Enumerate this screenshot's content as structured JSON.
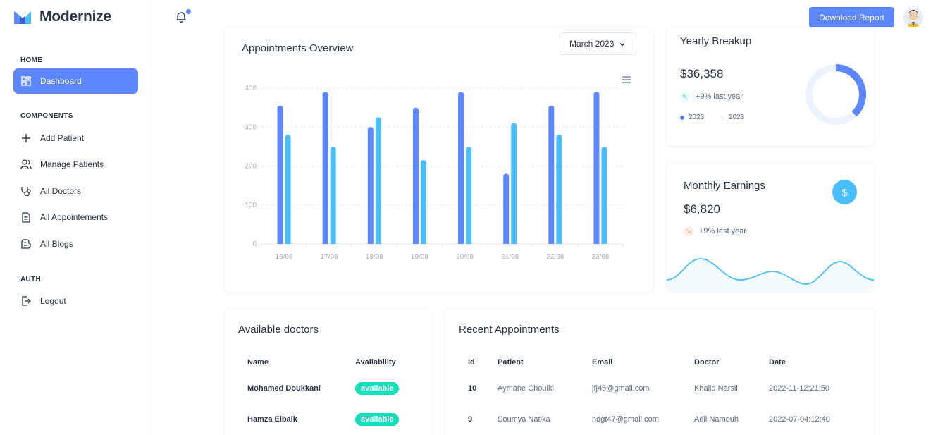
{
  "brand": {
    "name": "Modernize"
  },
  "sidebar": {
    "sections": [
      {
        "title": "HOME"
      },
      {
        "title": "COMPONENTS"
      },
      {
        "title": "AUTH"
      }
    ],
    "items": [
      {
        "label": "Dashboard",
        "icon": "dashboard-icon"
      },
      {
        "label": "Add Patient",
        "icon": "plus-icon"
      },
      {
        "label": "Manage Patients",
        "icon": "users-icon"
      },
      {
        "label": "All Doctors",
        "icon": "stethoscope-icon"
      },
      {
        "label": "All Appointements",
        "icon": "file-icon"
      },
      {
        "label": "All Blogs",
        "icon": "blog-icon"
      },
      {
        "label": "Logout",
        "icon": "logout-icon"
      }
    ]
  },
  "header": {
    "download_label": "Download Report"
  },
  "colors": {
    "accent": "#5d87ff",
    "secondary": "#49beff",
    "success": "#13deb9",
    "danger": "#fa896b"
  },
  "appointments": {
    "title": "Appointments Overview",
    "month_select": "March 2023"
  },
  "chart_data": {
    "type": "bar",
    "categories": [
      "16/08",
      "17/08",
      "18/08",
      "19/08",
      "20/08",
      "21/08",
      "22/08",
      "23/08"
    ],
    "series": [
      {
        "values": [
          355,
          390,
          300,
          350,
          390,
          180,
          355,
          390
        ],
        "color": "#5d87ff"
      },
      {
        "values": [
          280,
          250,
          325,
          215,
          250,
          310,
          280,
          250
        ],
        "color": "#49beff"
      }
    ],
    "yticks": [
      0,
      100,
      200,
      300,
      400
    ],
    "ylim": [
      0,
      400
    ],
    "grid": true
  },
  "yearly": {
    "title": "Yearly Breakup",
    "amount": "$36,358",
    "trend": "+9% last year",
    "legend": [
      "2023",
      "2023"
    ],
    "donut_fraction": 0.38
  },
  "monthly": {
    "title": "Monthly Earnings",
    "amount": "$6,820",
    "trend": "+9% last year"
  },
  "doctors": {
    "title": "Available doctors",
    "headers": [
      "Name",
      "Availability"
    ],
    "rows": [
      {
        "name": "Mohamed Doukkani",
        "status": "available"
      },
      {
        "name": "Hamza Elbaik",
        "status": "available"
      }
    ]
  },
  "recent": {
    "title": "Recent Appointments",
    "headers": [
      "Id",
      "Patient",
      "Email",
      "Doctor",
      "Date"
    ],
    "rows": [
      {
        "id": "10",
        "patient": "Aymane Chouiki",
        "email": "jfj45@gmail.com",
        "doctor": "Khalid Narsil",
        "date": "2022-11-12:21:50"
      },
      {
        "id": "9",
        "patient": "Soumya Natika",
        "email": "hdgt47@gmail.com",
        "doctor": "Adil Namouh",
        "date": "2022-07-04:12:40"
      }
    ]
  }
}
